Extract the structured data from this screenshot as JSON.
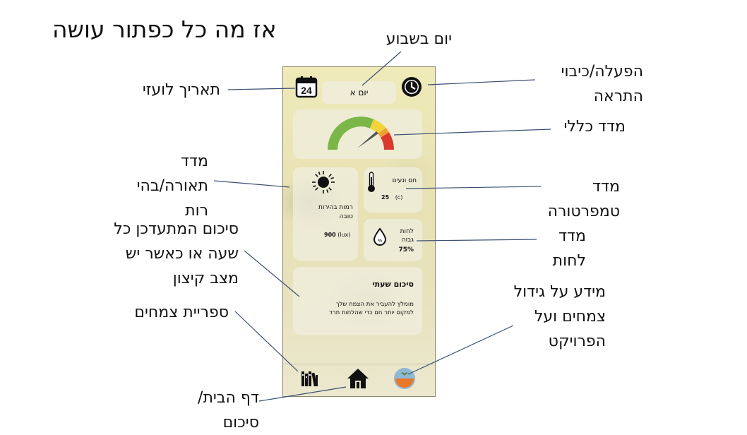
{
  "title": "אז מה כל כפתור עושה",
  "callouts": {
    "day_of_week": "יום בשבוע",
    "alarm_toggle_line1": "הפעלה/כיבוי",
    "alarm_toggle_line2": "התראה",
    "gregorian_date": "תאריך לועזי",
    "overall_gauge": "מדד כללי",
    "light_line1": "מדד",
    "light_line2": "תאורה/בהי",
    "light_line3": "רות",
    "temp_line1": "מדד",
    "temp_line2": "טמפרטורה",
    "hum_line1": "מדד",
    "hum_line2": "לחות",
    "summary_line1": "סיכום המתעדכן כל",
    "summary_line2": "שעה או כאשר יש",
    "summary_line3": "מצב קיצון",
    "info_line1": "מידע על גידול",
    "info_line2": "צמחים ועל",
    "info_line3": "הפרויקט",
    "library": "ספריית צמחים",
    "home_line1": "דף הבית/",
    "home_line2": "סיכום"
  },
  "phone": {
    "calendar_day": "24",
    "day_label": "יום א",
    "light_status_line1": "רמות בהירות",
    "light_status_line2": "טובה",
    "light_value": "900",
    "light_unit": "(lux)",
    "temp_status": "חם ונעים",
    "temp_value": "25",
    "temp_unit": "(c)",
    "hum_status_line1": "לחות",
    "hum_status_line2": "גבוה",
    "hum_value": "75%",
    "hum_drop_symbol": "%",
    "summary_title": "סיכום שעתי",
    "summary_line1": "מומלץ להעביר את הצמח שלך",
    "summary_line2": "למקום יותר חם כדי שהלחות תרד"
  },
  "colors": {
    "gauge_green": "#7ab648",
    "gauge_yellow": "#f2d33a",
    "gauge_orange": "#f0a030",
    "gauge_red": "#d83a2e",
    "info_orange": "#e8782a",
    "info_blue": "#8fb8d6"
  },
  "icons": {
    "calendar": "calendar-icon",
    "alarm": "alarm-clock-icon",
    "sun": "sun-icon",
    "thermometer": "thermometer-icon",
    "drop": "water-drop-icon",
    "library": "books-icon",
    "home": "home-icon",
    "info": "info-plant-pot-icon"
  }
}
